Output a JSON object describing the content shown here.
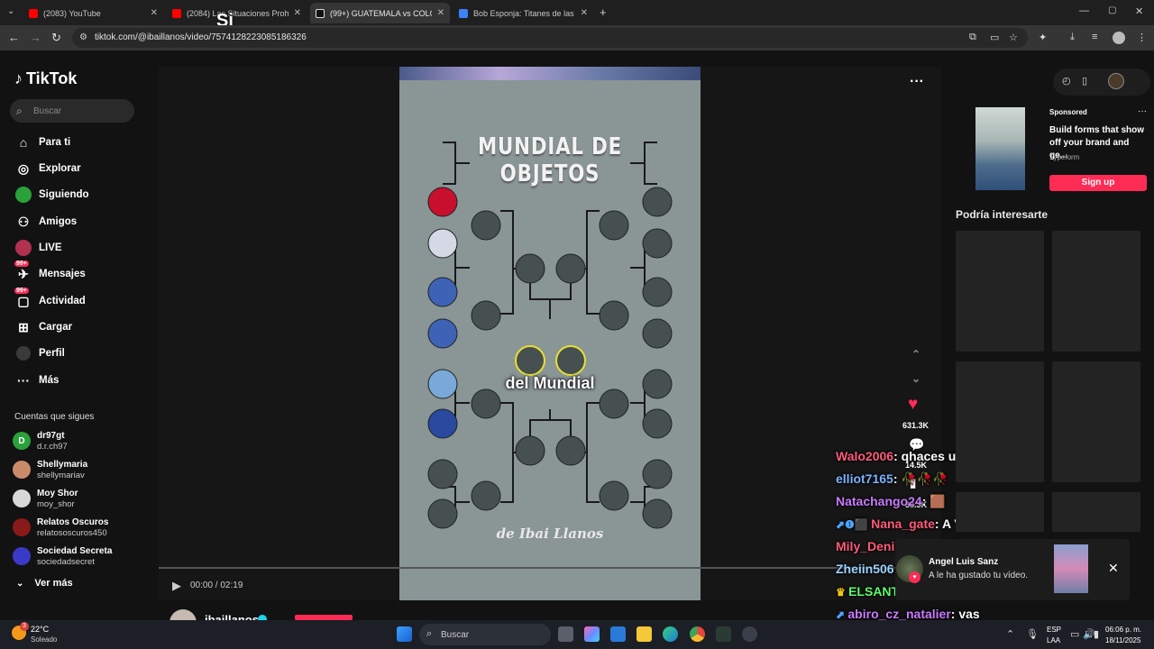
{
  "browser": {
    "tabs": [
      {
        "title": "(2083) YouTube",
        "color": "#ff0000"
      },
      {
        "title": "(2084) Las Situaciones Prohibi",
        "color": "#ff0000"
      },
      {
        "title": "(99+) GUATEMALA vs COLOMBI",
        "color": "#111111"
      },
      {
        "title": "Bob Esponja: Titanes de las ma",
        "color": "#3b82f6"
      }
    ],
    "url": "tiktok.com/@ibaillanos/video/7574128223085186326",
    "overlay_text": "Si"
  },
  "tiktok": {
    "logo": "TikTok",
    "search_placeholder": "Buscar",
    "menu": [
      {
        "label": "Para ti",
        "icon": "⌂"
      },
      {
        "label": "Explorar",
        "icon": "◎"
      },
      {
        "label": "Siguiendo",
        "icon": "●"
      },
      {
        "label": "Amigos",
        "icon": "👥"
      },
      {
        "label": "LIVE",
        "icon": "◉"
      },
      {
        "label": "Mensajes",
        "icon": "✈",
        "badge": "99+"
      },
      {
        "label": "Actividad",
        "icon": "▢",
        "badge": "99+"
      },
      {
        "label": "Cargar",
        "icon": "⊞"
      },
      {
        "label": "Perfil",
        "icon": "●"
      },
      {
        "label": "Más",
        "icon": "···"
      }
    ],
    "following_title": "Cuentas que sigues",
    "following": [
      {
        "name": "dr97gt",
        "handle": "d.r.ch97",
        "initial": "D",
        "color": "#2aa13a"
      },
      {
        "name": "Shellymaria",
        "handle": "shellymariav",
        "initial": "",
        "color": "#c98a6a"
      },
      {
        "name": "Moy Shor",
        "handle": "moy_shor",
        "initial": "",
        "color": "#d8d8d8"
      },
      {
        "name": "Relatos Oscuros",
        "handle": "relatososcuros450",
        "initial": "",
        "color": "#8a1a1a"
      },
      {
        "name": "Sociedad Secreta",
        "handle": "sociedadsecret",
        "initial": "",
        "color": "#3a3ac8"
      }
    ],
    "see_more": "Ver más"
  },
  "video": {
    "title": "MUNDIAL DE OBJETOS",
    "caption": "del Mundial",
    "signature": "de Ibai Llanos",
    "time": "00:00 / 02:19",
    "progress": 0,
    "likes": "631.3K",
    "comments": "14.5K",
    "saves": "33.3K",
    "author": "ibaillanos"
  },
  "chat": [
    {
      "user": "Walo2006",
      "msg": ": qhaces uacho",
      "color": "#ff5a7a"
    },
    {
      "user": "elliot7165",
      "msg": ": 🥀🥀🥀",
      "color": "#7fb2ff"
    },
    {
      "user": "Natachango24",
      "msg": ": 🟫",
      "color": "#c97bff"
    },
    {
      "user": "Nana_gate",
      "msg": ": A VA",
      "color": "#ff5a7a"
    },
    {
      "user": "Mily_Denisse_12",
      "msg": ": 🪨",
      "color": "#ff5a7a"
    },
    {
      "user": "Zheiin506",
      "msg": ":",
      "color": "#9ad4ff"
    },
    {
      "user": "ELSANTI208",
      "msg": ":",
      "color": "#5cff6a"
    },
    {
      "user": "abiro_cz_natalier",
      "msg": ": vas",
      "color": "#c97bff"
    }
  ],
  "ad": {
    "sponsored": "Sponsored",
    "text": "Build forms that show off your brand and ge...",
    "brand": "Typeform",
    "cta": "Sign up"
  },
  "suggestions_title": "Podría interesarte",
  "toast": {
    "name": "Angel Luis Sanz",
    "message": "A le ha gustado tu vídeo."
  },
  "taskbar": {
    "temp": "22°C",
    "weather": "Soleado",
    "search": "Buscar",
    "lang1": "ESP",
    "lang2": "LAA",
    "time": "06:06 p. m.",
    "date": "18/11/2025"
  }
}
